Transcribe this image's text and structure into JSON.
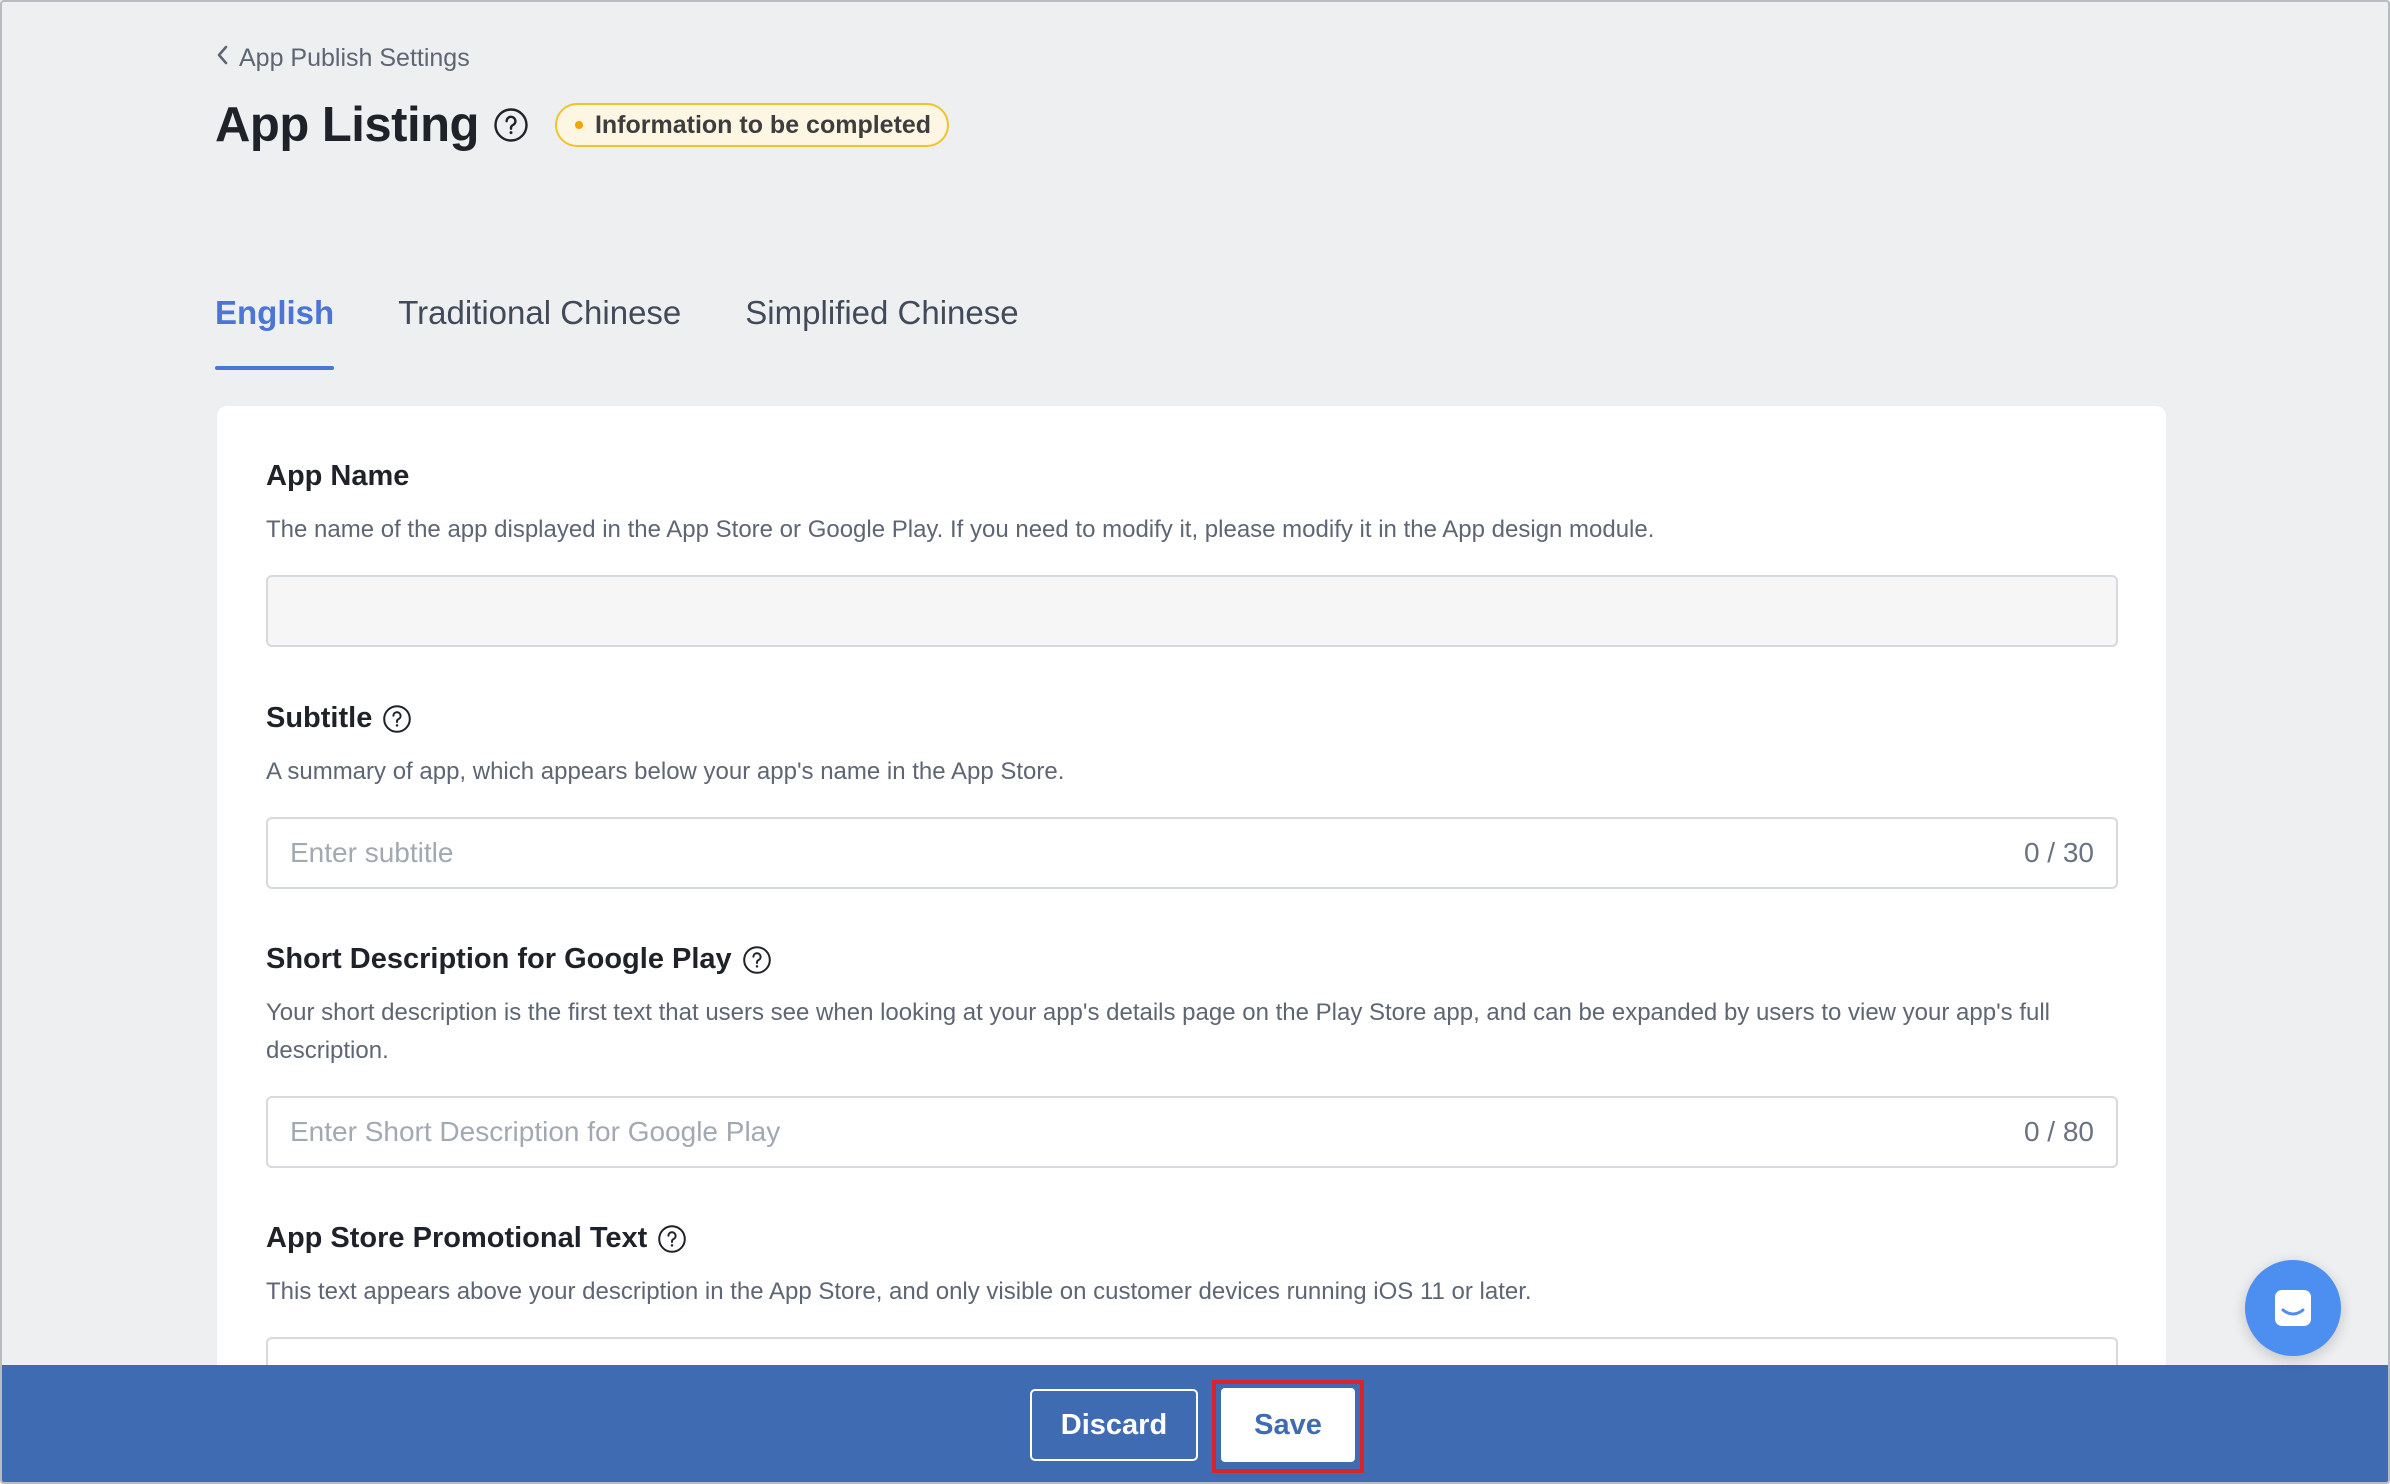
{
  "header": {
    "breadcrumb": "App Publish Settings",
    "title": "App Listing",
    "badge": "Information to be completed"
  },
  "tabs": [
    {
      "label": "English",
      "active": true
    },
    {
      "label": "Traditional Chinese",
      "active": false
    },
    {
      "label": "Simplified Chinese",
      "active": false
    }
  ],
  "form": {
    "app_name": {
      "label": "App Name",
      "description": "The name of the app displayed in the App Store or Google Play. If you need to modify it, please modify it in the App design module.",
      "value": ""
    },
    "subtitle": {
      "label": "Subtitle",
      "description": "A summary of app, which appears below your app's name in the App Store.",
      "placeholder": "Enter subtitle",
      "counter": "0 / 30"
    },
    "short_description": {
      "label": "Short Description for Google Play",
      "description": "Your short description is the first text that users see when looking at your app's details page on the Play Store app, and can be expanded by users to view your app's full description.",
      "placeholder": "Enter Short Description for Google Play",
      "counter": "0 / 80"
    },
    "promotional_text": {
      "label": "App Store Promotional Text",
      "description": "This text appears above your description in the App Store, and only visible on customer devices running iOS 11 or later."
    }
  },
  "footer": {
    "discard_label": "Discard",
    "save_label": "Save"
  },
  "colors": {
    "accent": "#4a76d6",
    "footer_bg": "#3f6bb3",
    "badge_border": "#f2c12e",
    "highlight": "#d9252a"
  },
  "icons": {
    "back": "chevron-left-icon",
    "help": "question-circle-icon",
    "chat": "chat-bubble-icon"
  }
}
